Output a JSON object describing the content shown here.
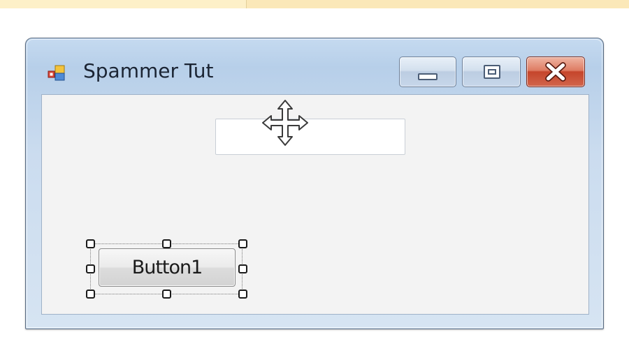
{
  "form": {
    "title": "Spammer Tut"
  },
  "caption_buttons": {
    "minimize_icon": "minimize-icon",
    "maximize_icon": "maximize-icon",
    "close_icon": "close-icon"
  },
  "controls": {
    "textbox": {
      "value": ""
    },
    "button1": {
      "label": "Button1",
      "selected": true
    }
  },
  "cursor": {
    "type": "move-icon"
  },
  "colors": {
    "close_button": "#c5452b",
    "title_bar": "#c5daf0",
    "client_area": "#f3f3f3"
  }
}
